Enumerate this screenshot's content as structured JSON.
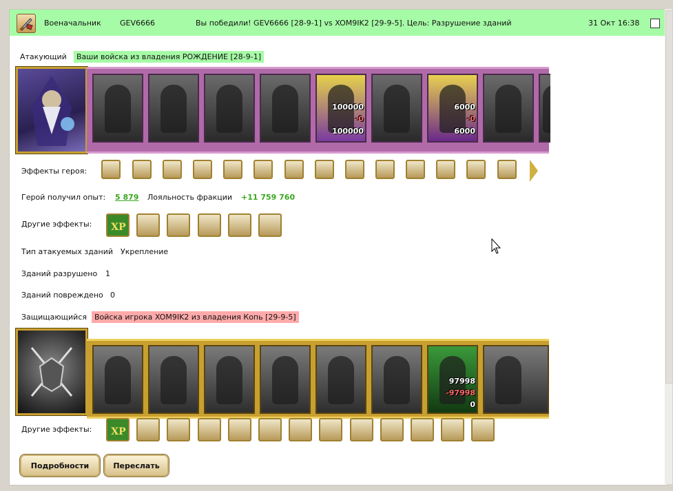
{
  "header": {
    "role": "Военачальник",
    "player": "GEV6666",
    "message": "Вы победили! GEV6666 [28-9-1] vs XOM9IK2 [29-9-5]. Цель: Разрушение зданий",
    "datetime": "31 Окт 16:38"
  },
  "attacker": {
    "label": "Атакующий",
    "troops": "Ваши войска из владения РОЖДЕНИЕ [28-9-1]",
    "units": [
      {
        "icon": "unit-dark-1"
      },
      {
        "icon": "unit-dark-2"
      },
      {
        "icon": "unit-dark-3"
      },
      {
        "icon": "unit-dark-4"
      },
      {
        "icon": "unit-purple-dragon",
        "count_top": "100000",
        "count_loss": "-0",
        "count_bottom": "100000"
      },
      {
        "icon": "unit-dark-5"
      },
      {
        "icon": "unit-sorceress",
        "count_top": "6000",
        "count_loss": "-0",
        "count_bottom": "6000"
      },
      {
        "icon": "unit-dark-6"
      },
      {
        "icon": "unit-dark-7"
      }
    ],
    "hero_effects_label": "Эффекты героя:",
    "experience_label": "Герой получил опыт:",
    "experience_value": "5 879",
    "loyalty_label": "Лояльность фракции",
    "loyalty_value": "+11 759 760",
    "other_effects_label": "Другие эффекты:",
    "buildings_type_label": "Тип атакуемых зданий",
    "buildings_type_value": "Укрепление",
    "destroyed_label": "Зданий разрушено",
    "destroyed_value": "1",
    "damaged_label": "Зданий повреждено",
    "damaged_value": "0"
  },
  "defender": {
    "label": "Защищающийся",
    "troops": "Войска игрока XOM9IK2 из владения Копь [29-9-5]",
    "units": [
      {
        "icon": "unit-dwarf"
      },
      {
        "icon": "unit-knight"
      },
      {
        "icon": "unit-warrior"
      },
      {
        "icon": "unit-griffin"
      },
      {
        "icon": "unit-archer"
      },
      {
        "icon": "unit-angel"
      },
      {
        "icon": "unit-green-mage",
        "count_top": "97998",
        "count_loss": "-97998",
        "count_bottom": "0"
      },
      {
        "icon": "unit-monk"
      }
    ],
    "other_effects_label": "Другие эффекты:"
  },
  "buttons": {
    "details": "Подробности",
    "forward": "Переслать"
  },
  "colors": {
    "header_bg": "#a6fba6",
    "attacker_highlight": "#a6fba6",
    "defender_highlight": "#ffaaaa",
    "value_green": "#3aa61f"
  }
}
